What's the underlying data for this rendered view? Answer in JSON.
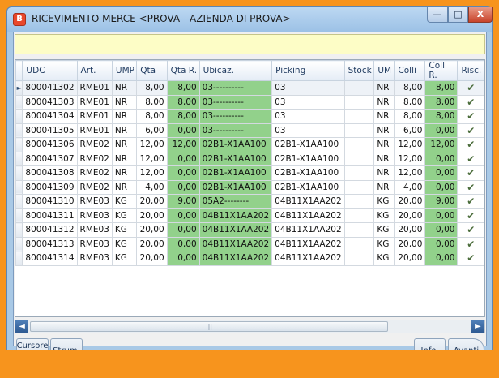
{
  "window": {
    "title": "RICEVIMENTO MERCE <PROVA - AZIENDA DI PROVA>",
    "app_icon": "B",
    "controls": {
      "minimize": "—",
      "maximize": "□",
      "close": "X"
    }
  },
  "colors": {
    "frame_bg": "#f7941d",
    "highlight": "#92d18b",
    "info_bar": "#fdfdc6"
  },
  "grid": {
    "columns": [
      "UDC",
      "Art.",
      "UMP",
      "Qta",
      "Qta R.",
      "Ubicaz.",
      "Picking",
      "Stock",
      "UM",
      "Colli",
      "Colli R.",
      "Risc."
    ],
    "current_row_marker": "►",
    "rows": [
      {
        "udc": "800041302",
        "art": "RME01",
        "ump": "NR",
        "qta": "8,00",
        "qtar": "8,00",
        "ubicaz": "03----------",
        "picking": "03",
        "stock": "",
        "um": "NR",
        "colli": "8,00",
        "collir": "8,00"
      },
      {
        "udc": "800041303",
        "art": "RME01",
        "ump": "NR",
        "qta": "8,00",
        "qtar": "8,00",
        "ubicaz": "03----------",
        "picking": "03",
        "stock": "",
        "um": "NR",
        "colli": "8,00",
        "collir": "8,00"
      },
      {
        "udc": "800041304",
        "art": "RME01",
        "ump": "NR",
        "qta": "8,00",
        "qtar": "8,00",
        "ubicaz": "03----------",
        "picking": "03",
        "stock": "",
        "um": "NR",
        "colli": "8,00",
        "collir": "8,00"
      },
      {
        "udc": "800041305",
        "art": "RME01",
        "ump": "NR",
        "qta": "6,00",
        "qtar": "0,00",
        "ubicaz": "03----------",
        "picking": "03",
        "stock": "",
        "um": "NR",
        "colli": "6,00",
        "collir": "0,00"
      },
      {
        "udc": "800041306",
        "art": "RME02",
        "ump": "NR",
        "qta": "12,00",
        "qtar": "12,00",
        "ubicaz": "02B1-X1AA100",
        "picking": "02B1-X1AA100",
        "stock": "",
        "um": "NR",
        "colli": "12,00",
        "collir": "12,00"
      },
      {
        "udc": "800041307",
        "art": "RME02",
        "ump": "NR",
        "qta": "12,00",
        "qtar": "0,00",
        "ubicaz": "02B1-X1AA100",
        "picking": "02B1-X1AA100",
        "stock": "",
        "um": "NR",
        "colli": "12,00",
        "collir": "0,00"
      },
      {
        "udc": "800041308",
        "art": "RME02",
        "ump": "NR",
        "qta": "12,00",
        "qtar": "0,00",
        "ubicaz": "02B1-X1AA100",
        "picking": "02B1-X1AA100",
        "stock": "",
        "um": "NR",
        "colli": "12,00",
        "collir": "0,00"
      },
      {
        "udc": "800041309",
        "art": "RME02",
        "ump": "NR",
        "qta": "4,00",
        "qtar": "0,00",
        "ubicaz": "02B1-X1AA100",
        "picking": "02B1-X1AA100",
        "stock": "",
        "um": "NR",
        "colli": "4,00",
        "collir": "0,00"
      },
      {
        "udc": "800041310",
        "art": "RME03",
        "ump": "KG",
        "qta": "20,00",
        "qtar": "9,00",
        "ubicaz": "05A2--------",
        "picking": "04B11X1AA202",
        "stock": "",
        "um": "KG",
        "colli": "20,00",
        "collir": "9,00"
      },
      {
        "udc": "800041311",
        "art": "RME03",
        "ump": "KG",
        "qta": "20,00",
        "qtar": "0,00",
        "ubicaz": "04B11X1AA202",
        "picking": "04B11X1AA202",
        "stock": "",
        "um": "KG",
        "colli": "20,00",
        "collir": "0,00"
      },
      {
        "udc": "800041312",
        "art": "RME03",
        "ump": "KG",
        "qta": "20,00",
        "qtar": "0,00",
        "ubicaz": "04B11X1AA202",
        "picking": "04B11X1AA202",
        "stock": "",
        "um": "KG",
        "colli": "20,00",
        "collir": "0,00"
      },
      {
        "udc": "800041313",
        "art": "RME03",
        "ump": "KG",
        "qta": "20,00",
        "qtar": "0,00",
        "ubicaz": "04B11X1AA202",
        "picking": "04B11X1AA202",
        "stock": "",
        "um": "KG",
        "colli": "20,00",
        "collir": "0,00"
      },
      {
        "udc": "800041314",
        "art": "RME03",
        "ump": "KG",
        "qta": "20,00",
        "qtar": "0,00",
        "ubicaz": "04B11X1AA202",
        "picking": "04B11X1AA202",
        "stock": "",
        "um": "KG",
        "colli": "20,00",
        "collir": "0,00"
      }
    ],
    "risc_icon": "checkmark-icon"
  },
  "scrollbar": {
    "left_arrow": "◄",
    "right_arrow": "►",
    "thumb_grip": "|||"
  },
  "toolbar": {
    "cursor_grid_label": "Cursore griglia",
    "tools_label": "Strum.",
    "info_label": "Info.",
    "next_label": "Avanti"
  }
}
